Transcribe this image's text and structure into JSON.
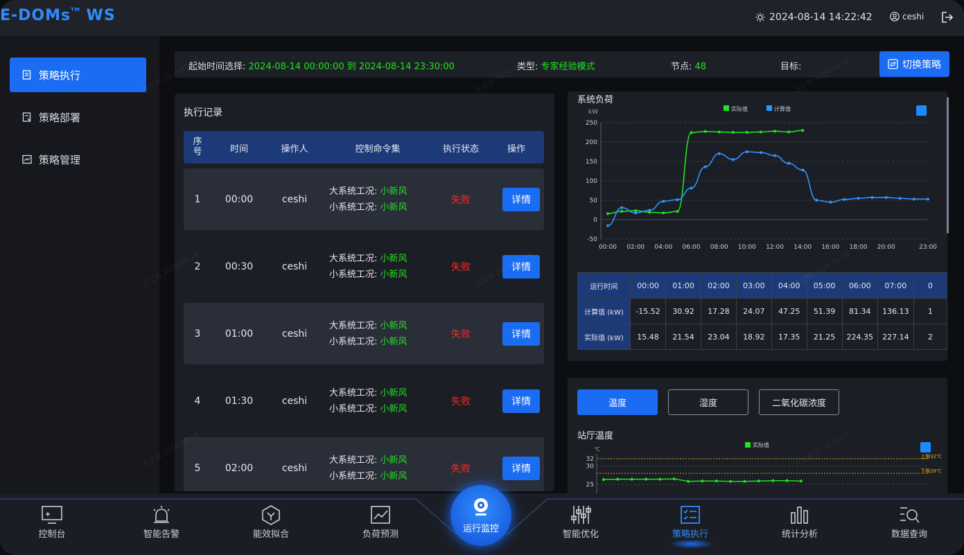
{
  "header": {
    "logo": "E-DOMs",
    "logo_tm": "TM",
    "logo_suffix": "WS",
    "datetime": "2024-08-14 14:22:42",
    "user": "ceshi"
  },
  "sidebar": {
    "items": [
      {
        "label": "策略执行",
        "active": true
      },
      {
        "label": "策略部署",
        "active": false
      },
      {
        "label": "策略管理",
        "active": false
      }
    ]
  },
  "filter": {
    "time_label": "起始时间选择:",
    "time_value": "2024-08-14 00:00:00 到 2024-08-14 23:30:00",
    "type_label": "类型:",
    "type_value": "专家经验模式",
    "node_label": "节点:",
    "node_value": "48",
    "target_label": "目标:",
    "switch_button": "切换策略"
  },
  "records": {
    "title": "执行记录",
    "headers": {
      "seq_a": "序",
      "seq_b": "号",
      "time": "时间",
      "operator": "操作人",
      "commands": "控制命令集",
      "status": "执行状态",
      "action": "操作"
    },
    "cmd_big_label": "大系统工况:",
    "cmd_small_label": "小系统工况:",
    "rows": [
      {
        "seq": "1",
        "time": "00:00",
        "operator": "ceshi",
        "big": "小新风",
        "small": "小新风",
        "status": "失败",
        "action": "详情"
      },
      {
        "seq": "2",
        "time": "00:30",
        "operator": "ceshi",
        "big": "小新风",
        "small": "小新风",
        "status": "失败",
        "action": "详情"
      },
      {
        "seq": "3",
        "time": "01:00",
        "operator": "ceshi",
        "big": "小新风",
        "small": "小新风",
        "status": "失败",
        "action": "详情"
      },
      {
        "seq": "4",
        "time": "01:30",
        "operator": "ceshi",
        "big": "小新风",
        "small": "小新风",
        "status": "失败",
        "action": "详情"
      },
      {
        "seq": "5",
        "time": "02:00",
        "operator": "ceshi",
        "big": "小新风",
        "small": "小新风",
        "status": "失败",
        "action": "详情"
      }
    ]
  },
  "chart_data": [
    {
      "type": "line",
      "title": "系统负荷",
      "ylabel": "kW",
      "ylim": [
        -50,
        250
      ],
      "yticks": [
        250,
        200,
        150,
        100,
        50,
        0,
        -50
      ],
      "xticks": [
        "00:00",
        "02:00",
        "04:00",
        "06:00",
        "08:00",
        "10:00",
        "12:00",
        "14:00",
        "16:00",
        "18:00",
        "20:00",
        "23:00"
      ],
      "grid": true,
      "legend": "top-center",
      "series": [
        {
          "name": "实际值",
          "color": "#21e321",
          "x": [
            0,
            1,
            2,
            3,
            4,
            5,
            6,
            7,
            8,
            9,
            10,
            11,
            12,
            13,
            14
          ],
          "values": [
            15.48,
            21.54,
            23.04,
            18.92,
            17.35,
            21.25,
            224.35,
            227.14,
            226,
            225,
            225,
            226,
            228,
            226,
            230
          ]
        },
        {
          "name": "计算值",
          "color": "#2e95ff",
          "x": [
            0,
            1,
            2,
            3,
            4,
            5,
            6,
            7,
            8,
            9,
            10,
            11,
            12,
            13,
            14,
            15,
            16,
            17,
            18,
            19,
            20,
            21,
            22,
            23
          ],
          "values": [
            -15.52,
            30.92,
            17.28,
            24.07,
            47.25,
            51.39,
            81.34,
            136.13,
            170,
            155,
            175,
            173,
            165,
            145,
            128,
            50,
            45,
            52,
            55,
            57,
            57,
            55,
            53,
            53
          ]
        }
      ]
    },
    {
      "type": "line",
      "title": "站厅温度",
      "ylabel": "℃",
      "yticks": [
        32,
        30,
        25
      ],
      "legend": "top-center",
      "annotations": [
        {
          "label": "上限32℃",
          "value": 32
        },
        {
          "label": "下限28℃",
          "value": 28
        }
      ],
      "series": [
        {
          "name": "实际值",
          "color": "#21e321",
          "x": [
            0,
            1,
            2,
            3,
            4,
            5,
            6,
            7,
            8,
            9,
            10,
            11,
            12,
            13,
            14
          ],
          "values": [
            26.3,
            26.4,
            26.4,
            26.4,
            26.4,
            26.5,
            25.8,
            25.9,
            25.9,
            25.8,
            25.8,
            25.9,
            26,
            26,
            25.9
          ]
        }
      ]
    }
  ],
  "run_table": {
    "row_headers": [
      "运行时间",
      "计算值 (kW)",
      "实际值 (kW)"
    ],
    "times": [
      "00:00",
      "01:00",
      "02:00",
      "03:00",
      "04:00",
      "05:00",
      "06:00",
      "07:00",
      "0"
    ],
    "calc": [
      "-15.52",
      "30.92",
      "17.28",
      "24.07",
      "47.25",
      "51.39",
      "81.34",
      "136.13",
      "1"
    ],
    "actual": [
      "15.48",
      "21.54",
      "23.04",
      "18.92",
      "17.35",
      "21.25",
      "224.35",
      "227.14",
      "2"
    ]
  },
  "env_tabs": [
    "温度",
    "湿度",
    "二氧化碳浓度"
  ],
  "bottom_nav": {
    "items": [
      "控制台",
      "智能告警",
      "能效拟合",
      "负荷预测",
      "智能优化",
      "策略执行",
      "统计分析",
      "数据查询"
    ],
    "center": "运行监控"
  },
  "watermark": "王文强 2024-08-14",
  "colors": {
    "accent": "#1a6cf3",
    "success": "#21e321",
    "danger": "#ff2626",
    "header_bg": "#1d3a78"
  }
}
